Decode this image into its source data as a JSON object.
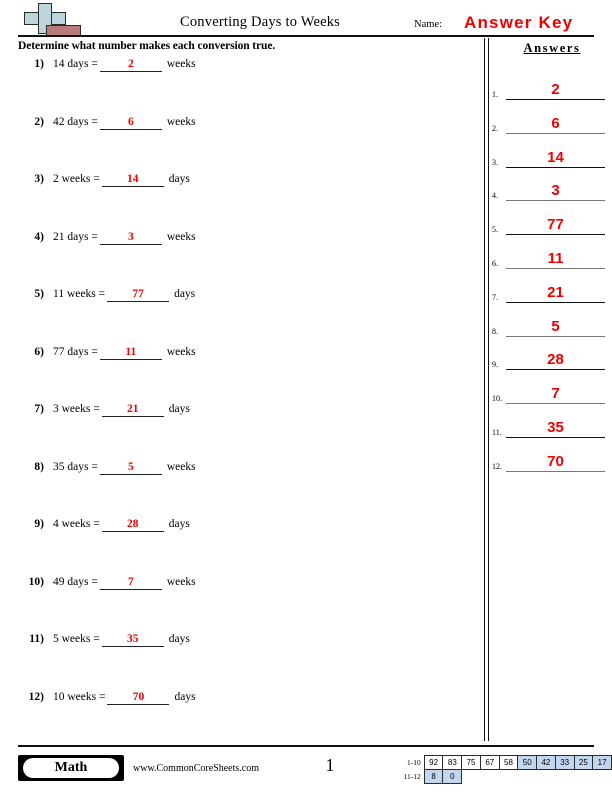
{
  "header": {
    "title": "Converting Days to Weeks",
    "name_label": "Name:",
    "answer_key": "Answer Key",
    "logo_colors": {
      "plus": "#bcd4dc",
      "bar": "#b97b7b",
      "outline": "#2b2b2b"
    }
  },
  "instruction": "Determine what number makes each conversion true.",
  "questions": [
    {
      "num": "1)",
      "left": "14 days =",
      "answer": "2",
      "right": "weeks"
    },
    {
      "num": "2)",
      "left": "42 days =",
      "answer": "6",
      "right": "weeks"
    },
    {
      "num": "3)",
      "left": "2 weeks =",
      "answer": "14",
      "right": "days"
    },
    {
      "num": "4)",
      "left": "21 days =",
      "answer": "3",
      "right": "weeks"
    },
    {
      "num": "5)",
      "left": "11 weeks =",
      "answer": "77",
      "right": "days"
    },
    {
      "num": "6)",
      "left": "77 days =",
      "answer": "11",
      "right": "weeks"
    },
    {
      "num": "7)",
      "left": "3 weeks =",
      "answer": "21",
      "right": "days"
    },
    {
      "num": "8)",
      "left": "35 days =",
      "answer": "5",
      "right": "weeks"
    },
    {
      "num": "9)",
      "left": "4 weeks =",
      "answer": "28",
      "right": "days"
    },
    {
      "num": "10)",
      "left": "49 days =",
      "answer": "7",
      "right": "weeks"
    },
    {
      "num": "11)",
      "left": "5 weeks =",
      "answer": "35",
      "right": "days"
    },
    {
      "num": "12)",
      "left": "10 weeks =",
      "answer": "70",
      "right": "days"
    }
  ],
  "answers_panel": {
    "heading": "Answers",
    "answer_color": "#ee0000",
    "rows": [
      {
        "idx": "1.",
        "value": "2"
      },
      {
        "idx": "2.",
        "value": "6"
      },
      {
        "idx": "3.",
        "value": "14"
      },
      {
        "idx": "4.",
        "value": "3"
      },
      {
        "idx": "5.",
        "value": "77"
      },
      {
        "idx": "6.",
        "value": "11"
      },
      {
        "idx": "7.",
        "value": "21"
      },
      {
        "idx": "8.",
        "value": "5"
      },
      {
        "idx": "9.",
        "value": "28"
      },
      {
        "idx": "10.",
        "value": "7"
      },
      {
        "idx": "11.",
        "value": "35"
      },
      {
        "idx": "12.",
        "value": "70"
      }
    ]
  },
  "footer": {
    "subject_badge": "Math",
    "website": "www.CommonCoreSheets.com",
    "page_number": "1",
    "score_table": {
      "highlight_color": "#c3d6ef",
      "rows": [
        {
          "range": "1-10",
          "cells": [
            {
              "value": "92",
              "highlighted": false
            },
            {
              "value": "83",
              "highlighted": false
            },
            {
              "value": "75",
              "highlighted": false
            },
            {
              "value": "67",
              "highlighted": false
            },
            {
              "value": "58",
              "highlighted": false
            },
            {
              "value": "50",
              "highlighted": true
            },
            {
              "value": "42",
              "highlighted": true
            },
            {
              "value": "33",
              "highlighted": true
            },
            {
              "value": "25",
              "highlighted": true
            },
            {
              "value": "17",
              "highlighted": true
            }
          ]
        },
        {
          "range": "11-12",
          "cells": [
            {
              "value": "8",
              "highlighted": true
            },
            {
              "value": "0",
              "highlighted": true
            }
          ]
        }
      ]
    }
  }
}
